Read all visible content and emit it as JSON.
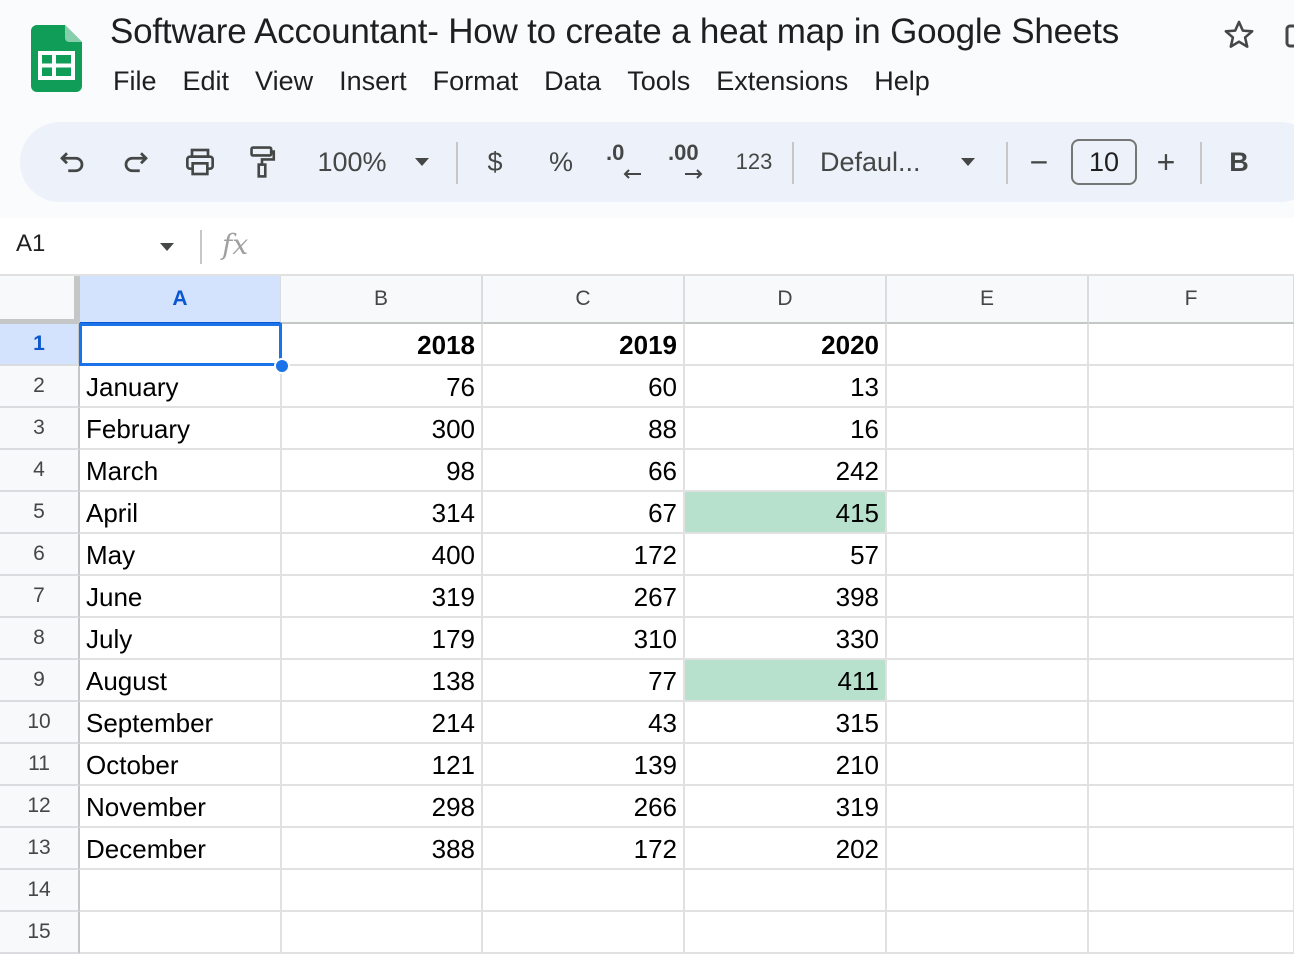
{
  "document": {
    "title": "Software Accountant- How to create a heat map in Google Sheets"
  },
  "menu": [
    "File",
    "Edit",
    "View",
    "Insert",
    "Format",
    "Data",
    "Tools",
    "Extensions",
    "Help"
  ],
  "toolbar": {
    "zoom": "100%",
    "currency": "$",
    "percent": "%",
    "decrease_decimal": ".0",
    "increase_decimal": ".00",
    "number_format": "123",
    "font": "Defaul...",
    "font_size": "10",
    "minus": "−",
    "plus": "+",
    "bold": "B"
  },
  "formula_bar": {
    "name_box": "A1",
    "fx": "fx",
    "content": ""
  },
  "grid": {
    "columns": [
      "A",
      "B",
      "C",
      "D",
      "E",
      "F"
    ],
    "rows": [
      "1",
      "2",
      "3",
      "4",
      "5",
      "6",
      "7",
      "8",
      "9",
      "10",
      "11",
      "12",
      "13",
      "14",
      "15"
    ],
    "cells": [
      [
        "",
        "2018",
        "2019",
        "2020",
        "",
        ""
      ],
      [
        "January",
        "76",
        "60",
        "13",
        "",
        ""
      ],
      [
        "February",
        "300",
        "88",
        "16",
        "",
        ""
      ],
      [
        "March",
        "98",
        "66",
        "242",
        "",
        ""
      ],
      [
        "April",
        "314",
        "67",
        "415",
        "",
        ""
      ],
      [
        "May",
        "400",
        "172",
        "57",
        "",
        ""
      ],
      [
        "June",
        "319",
        "267",
        "398",
        "",
        ""
      ],
      [
        "July",
        "179",
        "310",
        "330",
        "",
        ""
      ],
      [
        "August",
        "138",
        "77",
        "411",
        "",
        ""
      ],
      [
        "September",
        "214",
        "43",
        "315",
        "",
        ""
      ],
      [
        "October",
        "121",
        "139",
        "210",
        "",
        ""
      ],
      [
        "November",
        "298",
        "266",
        "319",
        "",
        ""
      ],
      [
        "December",
        "388",
        "172",
        "202",
        "",
        ""
      ],
      [
        "",
        "",
        "",
        "",
        "",
        ""
      ],
      [
        "",
        "",
        "",
        "",
        "",
        ""
      ]
    ],
    "highlighted_cells": [
      "D5",
      "D9"
    ],
    "active_cell": "A1"
  },
  "colors": {
    "heat_highlight": "#b7e1cd",
    "selection": "#1a73e8",
    "header_selected": "#d3e3fd",
    "toolbar_bg": "#edf2fa",
    "sheets_green": "#0f9d58"
  }
}
